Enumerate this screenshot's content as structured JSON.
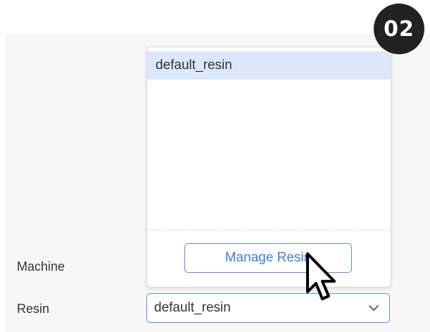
{
  "step_badge": "02",
  "resin_dropdown": {
    "options": [
      {
        "label": "default_resin",
        "highlighted": true
      }
    ],
    "manage_button_label": "Manage Resin"
  },
  "form": {
    "machine_label": "Machine",
    "resin_label": "Resin",
    "resin_value": "default_resin"
  },
  "icons": {
    "chevron": "chevron-down-icon",
    "cursor": "pointer-cursor-icon"
  },
  "colors": {
    "accent": "#4a8ff0",
    "selected_option_bg": "#dde7fb",
    "badge_bg": "#222222"
  }
}
